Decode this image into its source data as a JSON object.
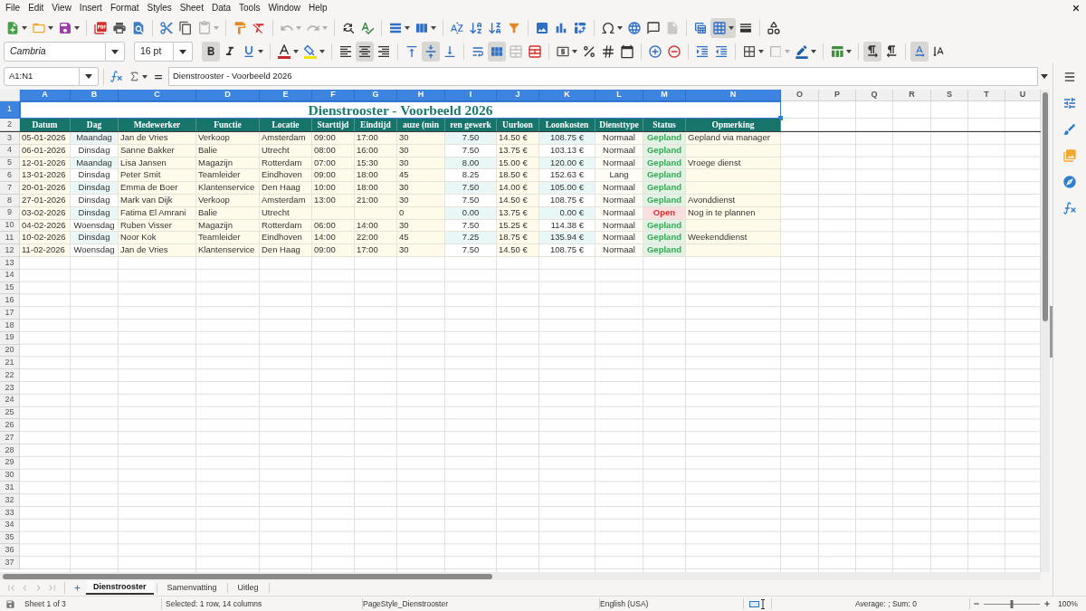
{
  "menu": [
    "File",
    "Edit",
    "View",
    "Insert",
    "Format",
    "Styles",
    "Sheet",
    "Data",
    "Tools",
    "Window",
    "Help"
  ],
  "toolbars": {
    "standard": [
      {
        "active": false,
        "disabled": false
      },
      {
        "active": false,
        "disabled": false
      },
      {
        "active": false,
        "disabled": false
      },
      {
        "active": false,
        "disabled": false
      },
      {
        "active": false,
        "disabled": false
      },
      {
        "active": false,
        "disabled": false
      },
      {
        "active": false,
        "disabled": false
      },
      {
        "active": false,
        "disabled": false
      },
      {
        "active": false,
        "disabled": true
      },
      {
        "active": false,
        "disabled": false
      },
      {
        "active": false,
        "disabled": false
      },
      {
        "active": false,
        "disabled": true
      },
      {
        "active": false,
        "disabled": true
      },
      {
        "active": false,
        "disabled": false
      },
      {
        "active": false,
        "disabled": false
      },
      {
        "active": false,
        "disabled": false
      },
      {
        "active": false,
        "disabled": false
      },
      {
        "active": false,
        "disabled": false
      },
      {
        "active": false,
        "disabled": false
      },
      {
        "active": false,
        "disabled": false
      },
      {
        "active": false,
        "disabled": false
      },
      {
        "active": false,
        "disabled": false
      },
      {
        "active": false,
        "disabled": false
      },
      {
        "active": false,
        "disabled": false
      },
      {
        "active": false,
        "disabled": false
      },
      {
        "active": false,
        "disabled": false
      },
      {
        "active": false,
        "disabled": false
      },
      {
        "active": false,
        "disabled": true
      },
      {
        "active": false,
        "disabled": false
      },
      {
        "active": true,
        "disabled": false
      },
      {
        "active": false,
        "disabled": false
      },
      {
        "active": false,
        "disabled": false
      }
    ],
    "formatting": {
      "font_name": "Cambria",
      "font_size": "16 pt",
      "buttons": [
        {
          "active": true,
          "disabled": false
        },
        {
          "active": false,
          "disabled": false
        },
        {
          "active": false,
          "disabled": false
        },
        {
          "active": false,
          "disabled": false
        },
        {
          "active": false,
          "disabled": false
        },
        {
          "active": false,
          "disabled": false
        },
        {
          "active": true,
          "disabled": false
        },
        {
          "active": false,
          "disabled": false
        },
        {
          "active": false,
          "disabled": false
        },
        {
          "active": true,
          "disabled": false
        },
        {
          "active": false,
          "disabled": false
        },
        {
          "active": false,
          "disabled": false
        },
        {
          "active": true,
          "disabled": false
        },
        {
          "active": false,
          "disabled": true
        },
        {
          "active": false,
          "disabled": false
        },
        {
          "active": false,
          "disabled": false
        },
        {
          "active": false,
          "disabled": false
        },
        {
          "active": false,
          "disabled": false
        },
        {
          "active": false,
          "disabled": false
        },
        {
          "active": false,
          "disabled": false
        },
        {
          "active": false,
          "disabled": false
        },
        {
          "active": false,
          "disabled": false
        },
        {
          "active": false,
          "disabled": false
        },
        {
          "active": false,
          "disabled": false
        },
        {
          "active": false,
          "disabled": true
        },
        {
          "active": false,
          "disabled": false
        },
        {
          "active": false,
          "disabled": false
        },
        {
          "active": true,
          "disabled": false
        },
        {
          "active": false,
          "disabled": false
        },
        {
          "active": true,
          "disabled": false
        },
        {
          "active": false,
          "disabled": false
        }
      ]
    }
  },
  "formula_bar": {
    "name_box": "A1:N1",
    "formula": "Dienstrooster - Voorbeeld 2026"
  },
  "sheet": {
    "columns": [
      {
        "label": "A",
        "selected": true
      },
      {
        "label": "B",
        "selected": true
      },
      {
        "label": "C",
        "selected": true
      },
      {
        "label": "D",
        "selected": true
      },
      {
        "label": "E",
        "selected": true
      },
      {
        "label": "F",
        "selected": true
      },
      {
        "label": "G",
        "selected": true
      },
      {
        "label": "H",
        "selected": true
      },
      {
        "label": "I",
        "selected": true
      },
      {
        "label": "J",
        "selected": true
      },
      {
        "label": "K",
        "selected": true
      },
      {
        "label": "L",
        "selected": true
      },
      {
        "label": "M",
        "selected": true
      },
      {
        "label": "N",
        "selected": true
      },
      {
        "label": "O",
        "selected": false
      },
      {
        "label": "P",
        "selected": false
      },
      {
        "label": "Q",
        "selected": false
      },
      {
        "label": "R",
        "selected": false
      },
      {
        "label": "S",
        "selected": false
      },
      {
        "label": "T",
        "selected": false
      },
      {
        "label": "U",
        "selected": false
      }
    ],
    "rows": [
      {
        "label": "1",
        "selected": true
      },
      {
        "label": "2",
        "selected": false
      },
      {
        "label": "3",
        "selected": false
      },
      {
        "label": "4",
        "selected": false
      },
      {
        "label": "5",
        "selected": false
      },
      {
        "label": "6",
        "selected": false
      },
      {
        "label": "7",
        "selected": false
      },
      {
        "label": "8",
        "selected": false
      },
      {
        "label": "9",
        "selected": false
      },
      {
        "label": "10",
        "selected": false
      },
      {
        "label": "11",
        "selected": false
      },
      {
        "label": "12",
        "selected": false
      },
      {
        "label": "13",
        "selected": false
      },
      {
        "label": "14",
        "selected": false
      },
      {
        "label": "15",
        "selected": false
      },
      {
        "label": "16",
        "selected": false
      },
      {
        "label": "17",
        "selected": false
      },
      {
        "label": "18",
        "selected": false
      },
      {
        "label": "19",
        "selected": false
      },
      {
        "label": "20",
        "selected": false
      },
      {
        "label": "21",
        "selected": false
      },
      {
        "label": "22",
        "selected": false
      },
      {
        "label": "23",
        "selected": false
      },
      {
        "label": "24",
        "selected": false
      },
      {
        "label": "25",
        "selected": false
      },
      {
        "label": "26",
        "selected": false
      },
      {
        "label": "27",
        "selected": false
      },
      {
        "label": "28",
        "selected": false
      },
      {
        "label": "29",
        "selected": false
      },
      {
        "label": "30",
        "selected": false
      },
      {
        "label": "31",
        "selected": false
      },
      {
        "label": "32",
        "selected": false
      },
      {
        "label": "33",
        "selected": false
      },
      {
        "label": "34",
        "selected": false
      },
      {
        "label": "35",
        "selected": false
      },
      {
        "label": "36",
        "selected": false
      },
      {
        "label": "37",
        "selected": false
      }
    ],
    "title": "Dienstrooster - Voorbeeld 2026",
    "headers": [
      "Datum",
      "Dag",
      "Medewerker",
      "Functie",
      "Locatie",
      "Starttijd",
      "Eindtijd",
      "auze (min",
      "ren gewerk",
      "Uurloon",
      "Loonkosten",
      "Diensttype",
      "Status",
      "Opmerking"
    ],
    "data": [
      {
        "cells": [
          "05-01-2026",
          "Maandag",
          "Jan de Vries",
          "Verkoop",
          "Amsterdam",
          "09:00",
          "17:00",
          "30",
          "7.50",
          "14.50 €",
          "108.75 €",
          "Normaal",
          "Gepland",
          "Gepland via manager"
        ],
        "kind": "planned"
      },
      {
        "cells": [
          "06-01-2026",
          "Dinsdag",
          "Sanne Bakker",
          "Balie",
          "Utrecht",
          "08:00",
          "16:00",
          "30",
          "7.50",
          "13.75 €",
          "103.13 €",
          "Normaal",
          "Gepland",
          null
        ],
        "kind": "planned"
      },
      {
        "cells": [
          "12-01-2026",
          "Maandag",
          "Lisa Jansen",
          "Magazijn",
          "Rotterdam",
          "07:00",
          "15:30",
          "30",
          "8.00",
          "15.00 €",
          "120.00 €",
          "Normaal",
          "Gepland",
          "Vroege dienst"
        ],
        "kind": "planned"
      },
      {
        "cells": [
          "13-01-2026",
          "Dinsdag",
          "Peter Smit",
          "Teamleider",
          "Eindhoven",
          "09:00",
          "18:00",
          "45",
          "8.25",
          "18.50 €",
          "152.63 €",
          "Lang",
          "Gepland",
          null
        ],
        "kind": "planned"
      },
      {
        "cells": [
          "20-01-2026",
          "Dinsdag",
          "Emma de Boer",
          "Klantenservice",
          "Den Haag",
          "10:00",
          "18:00",
          "30",
          "7.50",
          "14.00 €",
          "105.00 €",
          "Normaal",
          "Gepland",
          null
        ],
        "kind": "planned"
      },
      {
        "cells": [
          "27-01-2026",
          "Dinsdag",
          "Mark van Dijk",
          "Verkoop",
          "Amsterdam",
          "13:00",
          "21:00",
          "30",
          "7.50",
          "14.50 €",
          "108.75 €",
          "Normaal",
          "Gepland",
          "Avonddienst"
        ],
        "kind": "planned"
      },
      {
        "cells": [
          "03-02-2026",
          "Dinsdag",
          "Fatima El Amrani",
          "Balie",
          "Utrecht",
          null,
          null,
          "0",
          "0.00",
          "13.75 €",
          "0.00 €",
          "Normaal",
          "Open",
          "Nog in te plannen"
        ],
        "kind": "open"
      },
      {
        "cells": [
          "04-02-2026",
          "Woensdag",
          "Ruben Visser",
          "Magazijn",
          "Rotterdam",
          "06:00",
          "14:00",
          "30",
          "7.50",
          "15.25 €",
          "114.38 €",
          "Normaal",
          "Gepland",
          null
        ],
        "kind": "planned"
      },
      {
        "cells": [
          "10-02-2026",
          "Dinsdag",
          "Noor Kok",
          "Teamleider",
          "Eindhoven",
          "14:00",
          "22:00",
          "45",
          "7.25",
          "18.75 €",
          "135.94 €",
          "Normaal",
          "Gepland",
          "Weekenddienst"
        ],
        "kind": "planned"
      },
      {
        "cells": [
          "11-02-2026",
          "Woensdag",
          "Jan de Vries",
          "Klantenservice",
          "Den Haag",
          "09:00",
          "17:00",
          "30",
          "7.50",
          "14.50 €",
          "108.75 €",
          "Normaal",
          "Gepland",
          null
        ],
        "kind": "planned"
      }
    ]
  },
  "sheet_tabs": {
    "navigation": [
      {
        "disabled": true
      },
      {
        "disabled": true
      },
      {
        "disabled": true
      },
      {
        "disabled": true
      }
    ],
    "tabs": [
      {
        "label": "Dienstrooster",
        "selected": true
      },
      {
        "label": "Samenvatting",
        "selected": false
      },
      {
        "label": "Uitleg",
        "selected": false
      }
    ]
  },
  "status_bar": {
    "sheet": "Sheet 1 of 3",
    "selection": "Selected: 1 row, 14 columns",
    "page_style": "PageStyle_Dienstrooster",
    "language": "English (USA)",
    "summary": "Average: ; Sum: 0",
    "zoom": {
      "level": 0.5,
      "reading": "100%"
    }
  }
}
